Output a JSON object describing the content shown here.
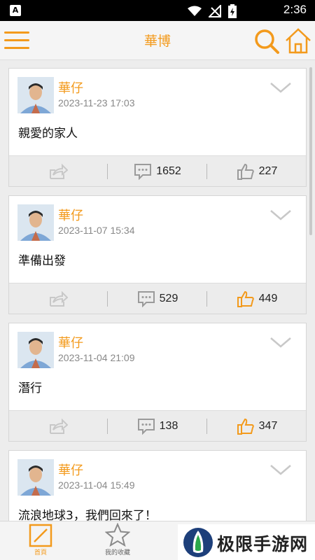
{
  "status": {
    "time": "2:36",
    "app_badge": "A"
  },
  "header": {
    "title": "華博"
  },
  "posts": [
    {
      "author": "華仔",
      "time": "2023-11-23 17:03",
      "content": "親愛的家人",
      "comments": "1652",
      "likes": "227",
      "liked": false
    },
    {
      "author": "華仔",
      "time": "2023-11-07 15:34",
      "content": "準備出發",
      "comments": "529",
      "likes": "449",
      "liked": true
    },
    {
      "author": "華仔",
      "time": "2023-11-04 21:09",
      "content": "潛行",
      "comments": "138",
      "likes": "347",
      "liked": true
    },
    {
      "author": "華仔",
      "time": "2023-11-04 15:49",
      "content": "流浪地球3，我們回來了！",
      "comments": "",
      "likes": "",
      "liked": false
    }
  ],
  "nav": {
    "home_label": "首頁",
    "fav_label": "我的收藏"
  },
  "watermark": {
    "text": "极限手游网"
  },
  "colors": {
    "accent": "#f39a1c",
    "text": "#111111",
    "muted": "#888888"
  }
}
